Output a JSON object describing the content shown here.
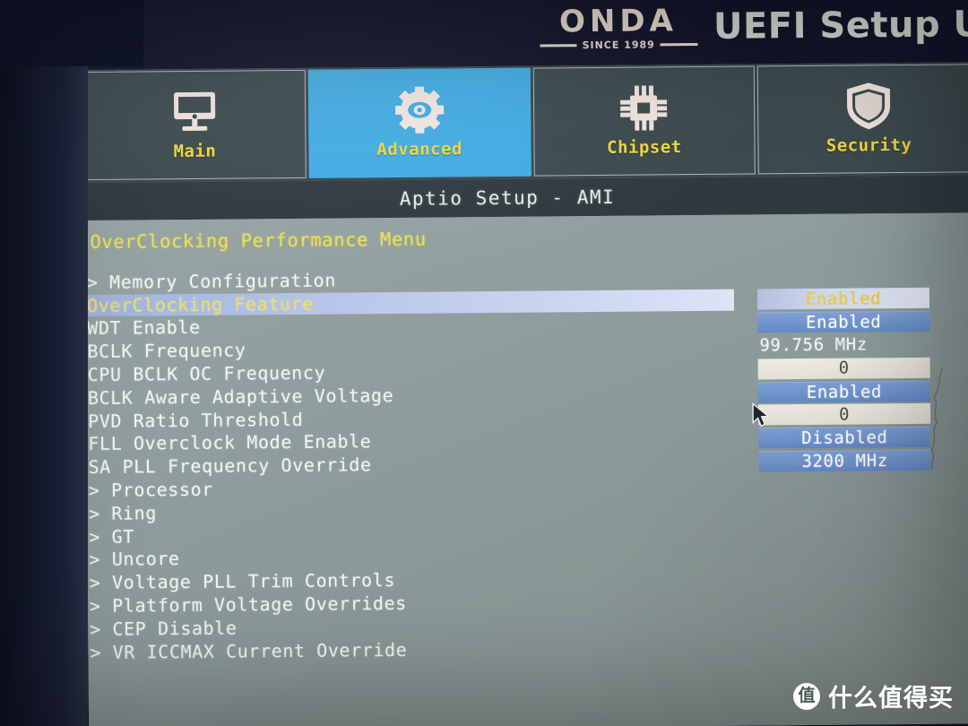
{
  "header": {
    "brand_word": "ONDA",
    "brand_since": "SINCE 1989",
    "app_title": "UEFI Setup Uti"
  },
  "tabs": [
    {
      "label": "Main",
      "icon": "monitor-icon",
      "active": false
    },
    {
      "label": "Advanced",
      "icon": "gear-icon",
      "active": true
    },
    {
      "label": "Chipset",
      "icon": "chip-icon",
      "active": false
    },
    {
      "label": "Security",
      "icon": "shield-icon",
      "active": false
    }
  ],
  "status_bar": {
    "text": "Aptio Setup - AMI"
  },
  "main": {
    "menu_title": "OverClocking Performance Menu",
    "rows": [
      {
        "label": "> Memory Configuration",
        "submenu": true,
        "selected": false,
        "value": null,
        "value_style": "none"
      },
      {
        "label": "OverClocking Feature",
        "submenu": false,
        "selected": true,
        "value": "Enabled",
        "value_style": "selected"
      },
      {
        "label": "WDT Enable",
        "submenu": false,
        "selected": false,
        "value": "Enabled",
        "value_style": "blue"
      },
      {
        "label": "BCLK Frequency",
        "submenu": false,
        "selected": false,
        "value": "99.756 MHz",
        "value_style": "plain"
      },
      {
        "label": "CPU BCLK OC Frequency",
        "submenu": false,
        "selected": false,
        "value": "0",
        "value_style": "light"
      },
      {
        "label": "BCLK Aware Adaptive Voltage",
        "submenu": false,
        "selected": false,
        "value": "Enabled",
        "value_style": "blue"
      },
      {
        "label": "PVD Ratio Threshold",
        "submenu": false,
        "selected": false,
        "value": "0",
        "value_style": "light"
      },
      {
        "label": "FLL Overclock Mode Enable",
        "submenu": false,
        "selected": false,
        "value": "Disabled",
        "value_style": "blue"
      },
      {
        "label": "SA PLL Frequency Override",
        "submenu": false,
        "selected": false,
        "value": "3200 MHz",
        "value_style": "blue"
      },
      {
        "label": "> Processor",
        "submenu": true,
        "selected": false,
        "value": null,
        "value_style": "none"
      },
      {
        "label": "> Ring",
        "submenu": true,
        "selected": false,
        "value": null,
        "value_style": "none"
      },
      {
        "label": "> GT",
        "submenu": true,
        "selected": false,
        "value": null,
        "value_style": "none"
      },
      {
        "label": "> Uncore",
        "submenu": true,
        "selected": false,
        "value": null,
        "value_style": "none"
      },
      {
        "label": "> Voltage PLL Trim Controls",
        "submenu": true,
        "selected": false,
        "value": null,
        "value_style": "none"
      },
      {
        "label": "> Platform Voltage Overrides",
        "submenu": true,
        "selected": false,
        "value": null,
        "value_style": "none"
      },
      {
        "label": "> CEP Disable",
        "submenu": true,
        "selected": false,
        "value": null,
        "value_style": "none"
      },
      {
        "label": "> VR ICCMAX Current Override",
        "submenu": true,
        "selected": false,
        "value": null,
        "value_style": "none"
      }
    ]
  },
  "cursor": {
    "icon": "mouse-pointer-icon"
  },
  "watermark": {
    "badge": "值",
    "text": "什么值得买"
  },
  "colors": {
    "accent_tab_active": "#41abe2",
    "label_yellow": "#f0d33c",
    "value_blue": "#6f94cd",
    "screen_bg": "#8e9d9c",
    "header_dark": "#12152a"
  }
}
